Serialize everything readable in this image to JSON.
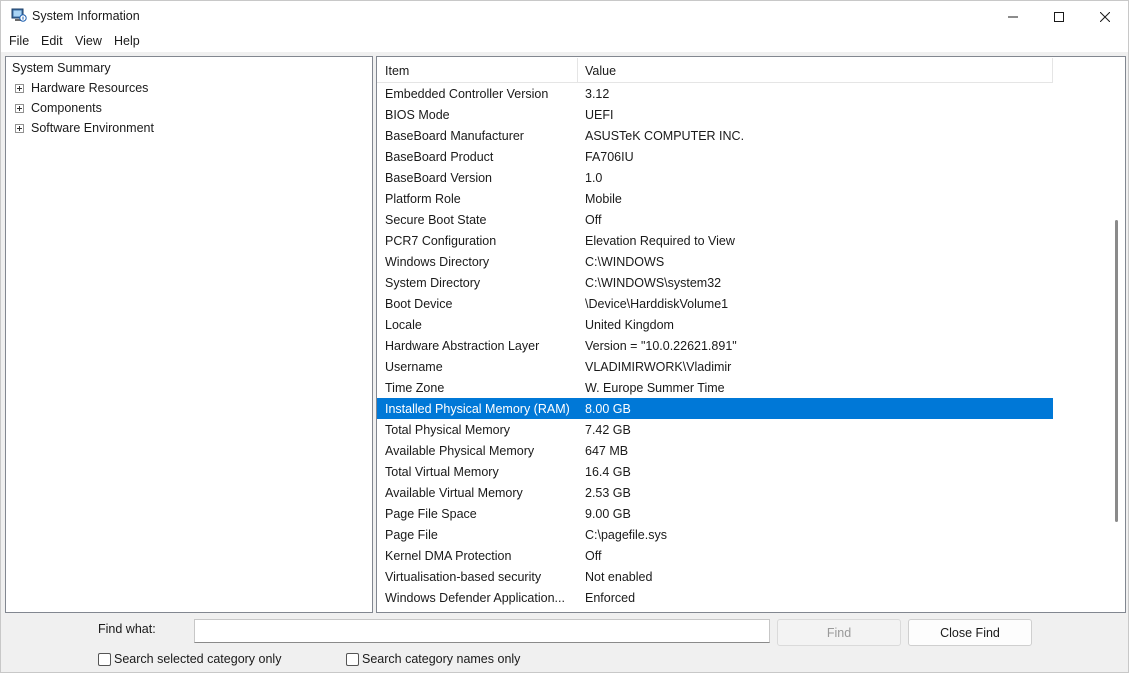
{
  "window": {
    "title": "System Information"
  },
  "menu": {
    "file": "File",
    "edit": "Edit",
    "view": "View",
    "help": "Help"
  },
  "tree": {
    "items": [
      {
        "label": "System Summary",
        "expandable": false
      },
      {
        "label": "Hardware Resources",
        "expandable": true
      },
      {
        "label": "Components",
        "expandable": true
      },
      {
        "label": "Software Environment",
        "expandable": true
      }
    ]
  },
  "list": {
    "columns": {
      "item": "Item",
      "value": "Value"
    },
    "rows": [
      {
        "item": "Embedded Controller Version",
        "value": "3.12"
      },
      {
        "item": "BIOS Mode",
        "value": "UEFI"
      },
      {
        "item": "BaseBoard Manufacturer",
        "value": "ASUSTeK COMPUTER INC."
      },
      {
        "item": "BaseBoard Product",
        "value": "FA706IU"
      },
      {
        "item": "BaseBoard Version",
        "value": "1.0"
      },
      {
        "item": "Platform Role",
        "value": "Mobile"
      },
      {
        "item": "Secure Boot State",
        "value": "Off"
      },
      {
        "item": "PCR7 Configuration",
        "value": "Elevation Required to View"
      },
      {
        "item": "Windows Directory",
        "value": "C:\\WINDOWS"
      },
      {
        "item": "System Directory",
        "value": "C:\\WINDOWS\\system32"
      },
      {
        "item": "Boot Device",
        "value": "\\Device\\HarddiskVolume1"
      },
      {
        "item": "Locale",
        "value": "United Kingdom"
      },
      {
        "item": "Hardware Abstraction Layer",
        "value": "Version = \"10.0.22621.891\""
      },
      {
        "item": "Username",
        "value": "VLADIMIRWORK\\Vladimir"
      },
      {
        "item": "Time Zone",
        "value": "W. Europe Summer Time"
      },
      {
        "item": "Installed Physical Memory (RAM)",
        "value": "8.00 GB",
        "selected": true
      },
      {
        "item": "Total Physical Memory",
        "value": "7.42 GB"
      },
      {
        "item": "Available Physical Memory",
        "value": "647 MB"
      },
      {
        "item": "Total Virtual Memory",
        "value": "16.4 GB"
      },
      {
        "item": "Available Virtual Memory",
        "value": "2.53 GB"
      },
      {
        "item": "Page File Space",
        "value": "9.00 GB"
      },
      {
        "item": "Page File",
        "value": "C:\\pagefile.sys"
      },
      {
        "item": "Kernel DMA Protection",
        "value": "Off"
      },
      {
        "item": "Virtualisation-based security",
        "value": "Not enabled"
      },
      {
        "item": "Windows Defender Application...",
        "value": "Enforced"
      }
    ]
  },
  "find": {
    "label": "Find what:",
    "value": "",
    "find_button": "Find",
    "close_find_button": "Close Find",
    "search_selected": "Search selected category only",
    "search_names": "Search category names only"
  },
  "colors": {
    "selection": "#0078d7"
  },
  "icons": {
    "app": "system-information-icon",
    "minimize": "minimize-icon",
    "maximize": "maximize-icon",
    "close": "close-icon"
  }
}
